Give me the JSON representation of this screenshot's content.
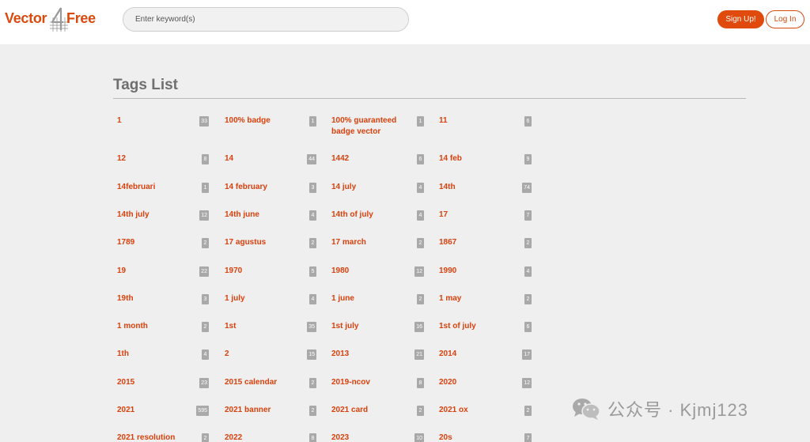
{
  "header": {
    "logo": {
      "left": "Vector",
      "right": "Free"
    },
    "search": {
      "placeholder": "Enter keyword(s)",
      "value": ""
    },
    "signup_label": "Sign Up!",
    "login_label": "Log In"
  },
  "main": {
    "title": "Tags List",
    "tags": [
      {
        "name": "1",
        "count": "33"
      },
      {
        "name": "100% badge",
        "count": "1"
      },
      {
        "name": "100% guaranteed badge vector",
        "count": "1"
      },
      {
        "name": "11",
        "count": "6"
      },
      {
        "name": "12",
        "count": "8"
      },
      {
        "name": "14",
        "count": "44"
      },
      {
        "name": "1442",
        "count": "6"
      },
      {
        "name": "14 feb",
        "count": "9"
      },
      {
        "name": "14februari",
        "count": "1"
      },
      {
        "name": "14 february",
        "count": "3"
      },
      {
        "name": "14 july",
        "count": "4"
      },
      {
        "name": "14th",
        "count": "74"
      },
      {
        "name": "14th july",
        "count": "12"
      },
      {
        "name": "14th june",
        "count": "4"
      },
      {
        "name": "14th of july",
        "count": "4"
      },
      {
        "name": "17",
        "count": "7"
      },
      {
        "name": "1789",
        "count": "2"
      },
      {
        "name": "17 agustus",
        "count": "2"
      },
      {
        "name": "17 march",
        "count": "2"
      },
      {
        "name": "1867",
        "count": "2"
      },
      {
        "name": "19",
        "count": "22"
      },
      {
        "name": "1970",
        "count": "5"
      },
      {
        "name": "1980",
        "count": "12"
      },
      {
        "name": "1990",
        "count": "4"
      },
      {
        "name": "19th",
        "count": "3"
      },
      {
        "name": "1 july",
        "count": "4"
      },
      {
        "name": "1 june",
        "count": "2"
      },
      {
        "name": "1 may",
        "count": "2"
      },
      {
        "name": "1 month",
        "count": "2"
      },
      {
        "name": "1st",
        "count": "35"
      },
      {
        "name": "1st july",
        "count": "16"
      },
      {
        "name": "1st of july",
        "count": "6"
      },
      {
        "name": "1th",
        "count": "4"
      },
      {
        "name": "2",
        "count": "15"
      },
      {
        "name": "2013",
        "count": "21"
      },
      {
        "name": "2014",
        "count": "17"
      },
      {
        "name": "2015",
        "count": "23"
      },
      {
        "name": "2015 calendar",
        "count": "2"
      },
      {
        "name": "2019-ncov",
        "count": "8"
      },
      {
        "name": "2020",
        "count": "12"
      },
      {
        "name": "2021",
        "count": "595"
      },
      {
        "name": "2021 banner",
        "count": "2"
      },
      {
        "name": "2021 card",
        "count": "2"
      },
      {
        "name": "2021 ox",
        "count": "2"
      },
      {
        "name": "2021 resolution",
        "count": "2"
      },
      {
        "name": "2022",
        "count": "8"
      },
      {
        "name": "2023",
        "count": "10"
      },
      {
        "name": "20s",
        "count": "7"
      }
    ]
  },
  "watermark": {
    "text": "公众号 · Kjmj123",
    "icon": "wechat-icon"
  },
  "colors": {
    "accent": "#d9400c",
    "badge": "#a9a9a9",
    "background": "#efefef"
  }
}
